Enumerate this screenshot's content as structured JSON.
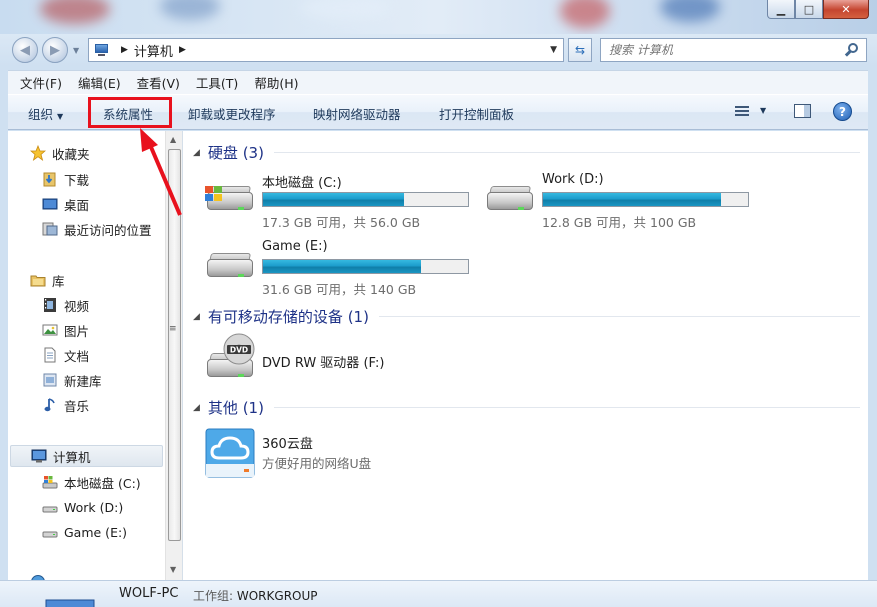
{
  "window": {
    "minimize": "▁",
    "maximize": "□",
    "close": "✕"
  },
  "address": {
    "crumb": "计算机",
    "search_placeholder": "搜索 计算机"
  },
  "menu": [
    "文件(F)",
    "编辑(E)",
    "查看(V)",
    "工具(T)",
    "帮助(H)"
  ],
  "toolbar": {
    "organize": "组织",
    "system_properties": "系统属性",
    "uninstall": "卸载或更改程序",
    "map_drive": "映射网络驱动器",
    "control_panel": "打开控制面板",
    "help": "?"
  },
  "nav": {
    "favorites": "收藏夹",
    "downloads": "下载",
    "desktop": "桌面",
    "recent": "最近访问的位置",
    "libraries": "库",
    "videos": "视频",
    "pictures": "图片",
    "documents": "文档",
    "new_library": "新建库",
    "music": "音乐",
    "computer": "计算机",
    "drive_c": "本地磁盘 (C:)",
    "drive_d": "Work (D:)",
    "drive_e": "Game (E:)"
  },
  "groups": {
    "hdd": "硬盘 (3)",
    "removable": "有可移动存储的设备 (1)",
    "other": "其他 (1)"
  },
  "drives": [
    {
      "name": "本地磁盘 (C:)",
      "free": "17.3 GB 可用，共 56.0 GB",
      "used_fraction": 0.69
    },
    {
      "name": "Work (D:)",
      "free": "12.8 GB 可用，共 100 GB",
      "used_fraction": 0.87
    },
    {
      "name": "Game (E:)",
      "free": "31.6 GB 可用，共 140 GB",
      "used_fraction": 0.77
    }
  ],
  "dvd": {
    "name": "DVD RW 驱动器 (F:)",
    "label": "DVD"
  },
  "cloud": {
    "name": "360云盘",
    "desc": "方便好用的网络U盘"
  },
  "details": {
    "pc_name": "WOLF-PC",
    "workgroup_label": "工作组:",
    "workgroup": "WORKGROUP"
  },
  "colors": {
    "highlight": "#e8111d",
    "group_title": "#1e3287",
    "bar_fill": "#1d9dcc"
  }
}
